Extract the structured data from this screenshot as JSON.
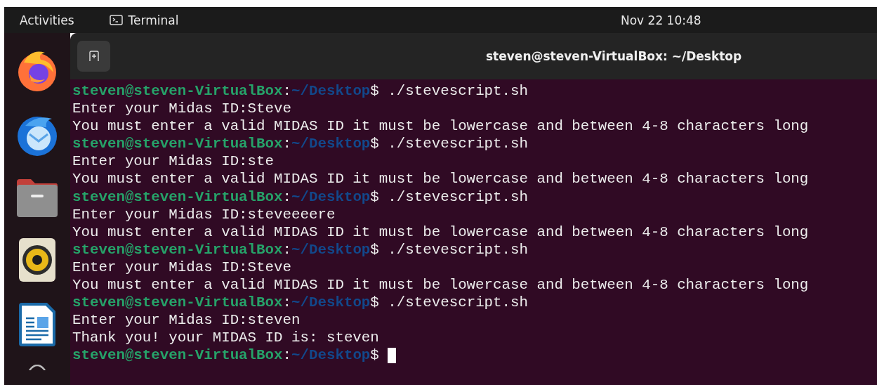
{
  "top_bar": {
    "activities": "Activities",
    "app_name": "Terminal",
    "clock": "Nov 22  10:48"
  },
  "window": {
    "title": "steven@steven-VirtualBox: ~/Desktop"
  },
  "terminal": {
    "lines": [
      {
        "kind": "prompt",
        "user_host": "steven@steven-VirtualBox",
        "separator": ":",
        "path": "~/Desktop",
        "symbol": "$",
        "command": "./stevescript.sh"
      },
      {
        "kind": "output",
        "text": "Enter your Midas ID:Steve"
      },
      {
        "kind": "output",
        "text": "You must enter a valid MIDAS ID it must be lowercase and between 4-8 characters long"
      },
      {
        "kind": "prompt",
        "user_host": "steven@steven-VirtualBox",
        "separator": ":",
        "path": "~/Desktop",
        "symbol": "$",
        "command": "./stevescript.sh"
      },
      {
        "kind": "output",
        "text": "Enter your Midas ID:ste"
      },
      {
        "kind": "output",
        "text": "You must enter a valid MIDAS ID it must be lowercase and between 4-8 characters long"
      },
      {
        "kind": "prompt",
        "user_host": "steven@steven-VirtualBox",
        "separator": ":",
        "path": "~/Desktop",
        "symbol": "$",
        "command": "./stevescript.sh"
      },
      {
        "kind": "output",
        "text": "Enter your Midas ID:steveeeere"
      },
      {
        "kind": "output",
        "text": "You must enter a valid MIDAS ID it must be lowercase and between 4-8 characters long"
      },
      {
        "kind": "prompt",
        "user_host": "steven@steven-VirtualBox",
        "separator": ":",
        "path": "~/Desktop",
        "symbol": "$",
        "command": "./stevescript.sh"
      },
      {
        "kind": "output",
        "text": "Enter your Midas ID:Steve"
      },
      {
        "kind": "output",
        "text": "You must enter a valid MIDAS ID it must be lowercase and between 4-8 characters long"
      },
      {
        "kind": "prompt",
        "user_host": "steven@steven-VirtualBox",
        "separator": ":",
        "path": "~/Desktop",
        "symbol": "$",
        "command": "./stevescript.sh"
      },
      {
        "kind": "output",
        "text": "Enter your Midas ID:steven"
      },
      {
        "kind": "output",
        "text": "Thank you! your MIDAS ID is: steven"
      },
      {
        "kind": "prompt",
        "user_host": "steven@steven-VirtualBox",
        "separator": ":",
        "path": "~/Desktop",
        "symbol": "$",
        "cursor": true
      }
    ]
  }
}
